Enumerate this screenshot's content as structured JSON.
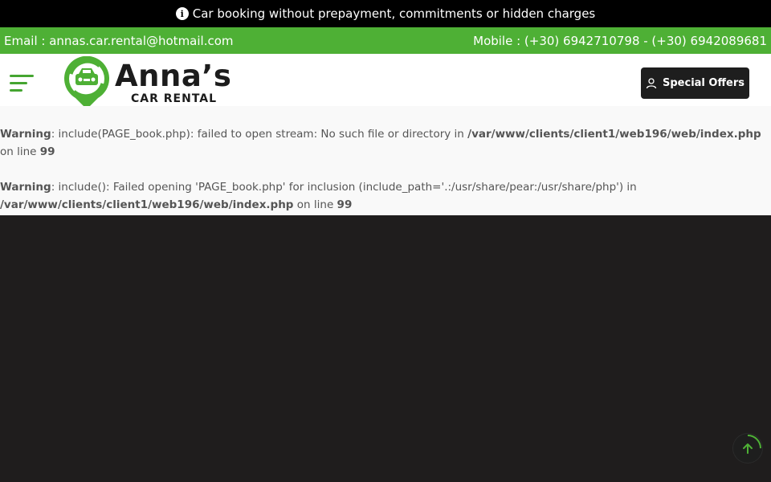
{
  "announcement": {
    "icon": "info-circle-icon",
    "text": "Car booking without prepayment, commitments or hidden charges"
  },
  "contact": {
    "email": "Email : annas.car.rental@hotmail.com",
    "mobile": "Mobile : (+30) 6942710798 - (+30) 6942089681"
  },
  "header": {
    "menu_icon": "hamburger-menu-icon",
    "logo_name": "Anna’s",
    "logo_sub": "CAR RENTAL",
    "offers_label": "Special Offers",
    "offers_icon": "user-icon"
  },
  "warnings": [
    {
      "label": "Warning",
      "text1": ": include(PAGE_book.php): failed to open stream: No such file or directory in ",
      "path": "/var/www/clients/client1/web196/web/index.php",
      "text2": " on line ",
      "line": "99"
    },
    {
      "label": "Warning",
      "text1": ": include(): Failed opening 'PAGE_book.php' for inclusion (include_path='.:/usr/share/pear:/usr/share/php') in ",
      "path": "/var/www/clients/client1/web196/web/index.php",
      "text2": " on line ",
      "line": "99"
    }
  ],
  "scroll_top": {
    "icon": "arrow-up-icon"
  },
  "colors": {
    "brand_green": "#4eb035",
    "dark": "#1e1e1e",
    "background": "#1f1d1d"
  }
}
